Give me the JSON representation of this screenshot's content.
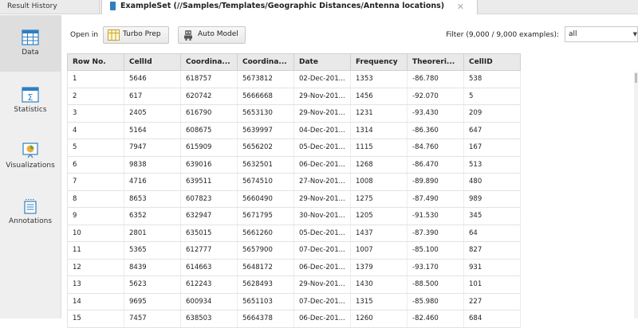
{
  "tabs": {
    "result_history": "Result History",
    "example_set": "ExampleSet (//Samples/Templates/Geographic Distances/Antenna locations)"
  },
  "sidebar": {
    "items": [
      {
        "label": "Data",
        "icon": "data-table-icon",
        "active": true
      },
      {
        "label": "Statistics",
        "icon": "statistics-icon",
        "active": false
      },
      {
        "label": "Visualizations",
        "icon": "visualizations-icon",
        "active": false
      },
      {
        "label": "Annotations",
        "icon": "annotations-icon",
        "active": false
      }
    ]
  },
  "toolbar": {
    "open_in": "Open in",
    "turbo_prep": "Turbo Prep",
    "auto_model": "Auto Model",
    "filter_label": "Filter (9,000 / 9,000 examples):",
    "filter_value": "all"
  },
  "table": {
    "columns": [
      "Row No.",
      "CellId",
      "Coordina...",
      "Coordina...",
      "Date",
      "Frequency",
      "Theoreri...",
      "CellID"
    ],
    "rows": [
      [
        "1",
        "5646",
        "618757",
        "5673812",
        "02-Dec-201...",
        "1353",
        "-86.780",
        "538"
      ],
      [
        "2",
        "617",
        "620742",
        "5666668",
        "29-Nov-201...",
        "1456",
        "-92.070",
        "5"
      ],
      [
        "3",
        "2405",
        "616790",
        "5653130",
        "29-Nov-201...",
        "1231",
        "-93.430",
        "209"
      ],
      [
        "4",
        "5164",
        "608675",
        "5639997",
        "04-Dec-201...",
        "1314",
        "-86.360",
        "647"
      ],
      [
        "5",
        "7947",
        "615909",
        "5656202",
        "05-Dec-201...",
        "1115",
        "-84.760",
        "167"
      ],
      [
        "6",
        "9838",
        "639016",
        "5632501",
        "06-Dec-201...",
        "1268",
        "-86.470",
        "513"
      ],
      [
        "7",
        "4716",
        "639511",
        "5674510",
        "27-Nov-201...",
        "1008",
        "-89.890",
        "480"
      ],
      [
        "8",
        "8653",
        "607823",
        "5660490",
        "29-Nov-201...",
        "1275",
        "-87.490",
        "989"
      ],
      [
        "9",
        "6352",
        "632947",
        "5671795",
        "30-Nov-201...",
        "1205",
        "-91.530",
        "345"
      ],
      [
        "10",
        "2801",
        "635015",
        "5661260",
        "05-Dec-201...",
        "1437",
        "-87.390",
        "64"
      ],
      [
        "11",
        "5365",
        "612777",
        "5657900",
        "07-Dec-201...",
        "1007",
        "-85.100",
        "827"
      ],
      [
        "12",
        "8439",
        "614663",
        "5648172",
        "06-Dec-201...",
        "1379",
        "-93.170",
        "931"
      ],
      [
        "13",
        "5623",
        "612243",
        "5628493",
        "29-Nov-201...",
        "1430",
        "-88.500",
        "101"
      ],
      [
        "14",
        "9695",
        "600934",
        "5651103",
        "07-Dec-201...",
        "1315",
        "-85.980",
        "227"
      ],
      [
        "15",
        "7457",
        "638503",
        "5664378",
        "06-Dec-201...",
        "1260",
        "-82.460",
        "684"
      ]
    ]
  },
  "colors": {
    "accent": "#2f7fc1",
    "sidebar_active": "#dedede",
    "header_bg": "#e9e9e9"
  }
}
